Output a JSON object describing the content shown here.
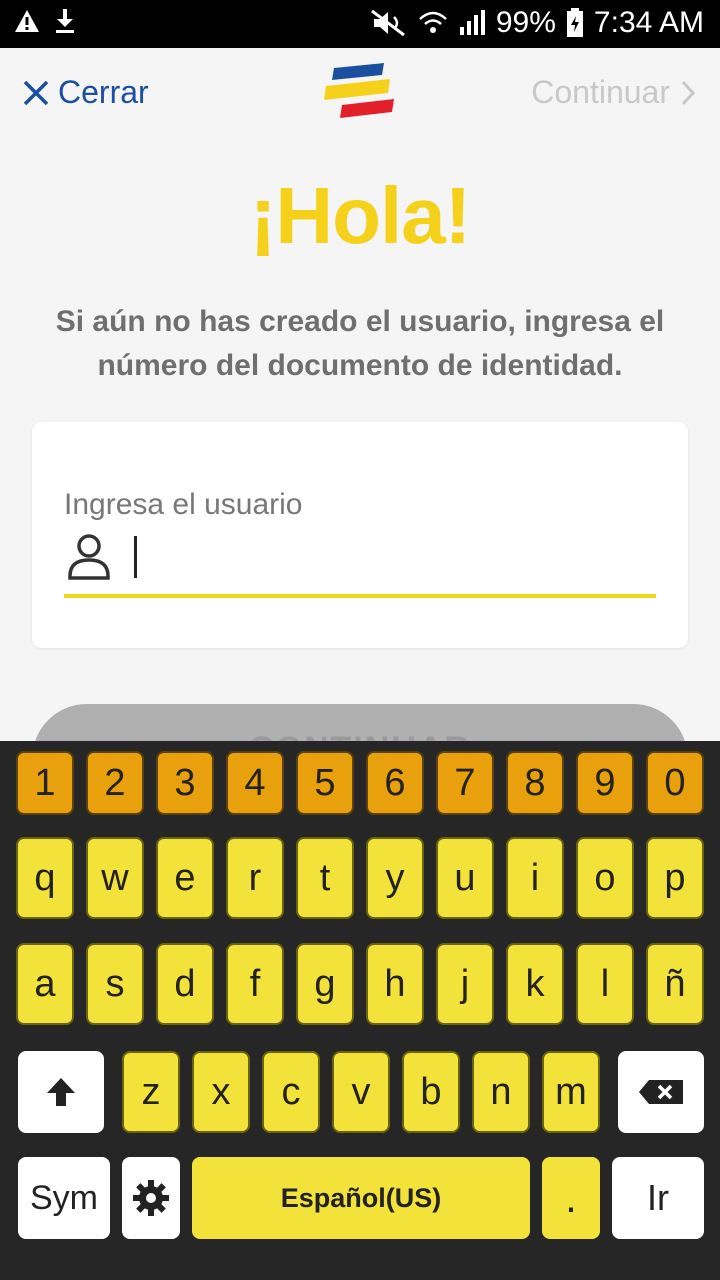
{
  "status_bar": {
    "battery": "99%",
    "time": "7:34 AM"
  },
  "header": {
    "close_label": "Cerrar",
    "continue_label": "Continuar"
  },
  "main": {
    "title": "¡Hola!",
    "subtitle": "Si aún no has creado el usuario, ingresa el número del documento de identidad.",
    "username_label": "Ingresa el usuario",
    "username_value": "",
    "continue_button": "CONTINUAR"
  },
  "keyboard": {
    "row_numbers": [
      "1",
      "2",
      "3",
      "4",
      "5",
      "6",
      "7",
      "8",
      "9",
      "0"
    ],
    "row_top": [
      "q",
      "w",
      "e",
      "r",
      "t",
      "y",
      "u",
      "i",
      "o",
      "p"
    ],
    "row_mid": [
      "a",
      "s",
      "d",
      "f",
      "g",
      "h",
      "j",
      "k",
      "l",
      "ñ"
    ],
    "row_bottom": [
      "z",
      "x",
      "c",
      "v",
      "b",
      "n",
      "m"
    ],
    "sym_label": "Sym",
    "space_label": "Español(US)",
    "period_label": ".",
    "enter_label": "Ir"
  },
  "colors": {
    "brand_yellow": "#f6d11b",
    "brand_blue": "#1b4fa0",
    "brand_red": "#e3202a",
    "number_key": "#e8a10c",
    "letter_key": "#f3e23a"
  }
}
